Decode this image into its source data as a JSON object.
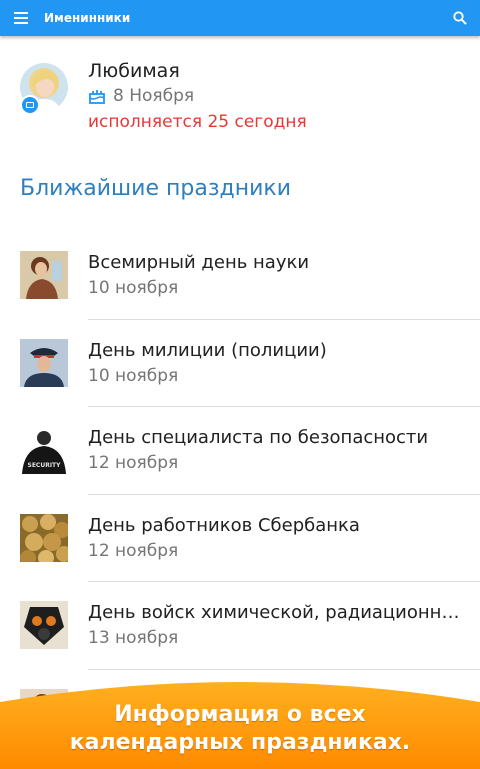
{
  "app": {
    "title": "Именинники"
  },
  "birthday": {
    "name": "Любимая",
    "date": "8 Ноября",
    "age_text": "исполняется 25 сегодня"
  },
  "section_title": "Ближайшие праздники",
  "holidays": [
    {
      "name": "Всемирный день науки",
      "date": "10 ноября"
    },
    {
      "name": "День милиции (полиции)",
      "date": "10 ноября"
    },
    {
      "name": "День специалиста по безопасности",
      "date": "12 ноября",
      "thumb_text": "SECURITY"
    },
    {
      "name": "День работников Сбербанка",
      "date": "12 ноября"
    },
    {
      "name": "День войск химической, радиационной…",
      "date": "13 ноября"
    }
  ],
  "promo": {
    "line1": "Информация о всех",
    "line2": "календарных праздниках."
  },
  "colors": {
    "appbar": "#2196f3",
    "section_title": "#2f7fbf",
    "age_text": "#e53935",
    "promo_orange": "#ff9a0a"
  }
}
